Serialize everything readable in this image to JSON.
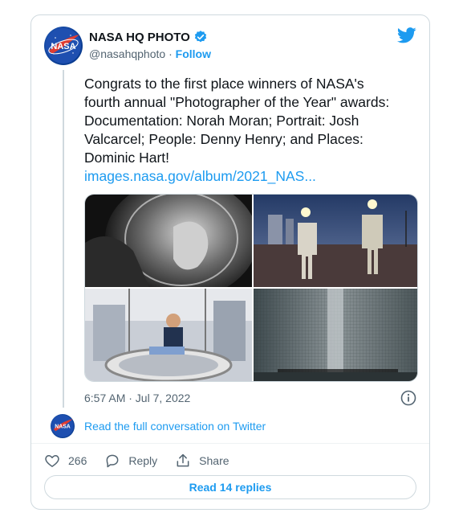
{
  "author": {
    "name": "NASA HQ PHOTO",
    "handle": "@nasahqphoto",
    "separator": "·",
    "follow_label": "Follow",
    "logo_text": "NASA"
  },
  "tweet": {
    "text": "Congrats to the first place winners of NASA's\nfourth annual \"Photographer of the Year\" awards:\nDocumentation: Norah Moran; Portrait: Josh\nValcarcel; People: Denny Henry; and Places:\nDominic Hart!",
    "link": "images.nasa.gov/album/2021_NAS...",
    "timestamp": "6:57 AM · Jul 7, 2022"
  },
  "media": [
    {
      "icon": "astronaut-portrait-photo"
    },
    {
      "icon": "spacesuit-night-photo"
    },
    {
      "icon": "worker-in-ring-photo"
    },
    {
      "icon": "large-hall-photo"
    }
  ],
  "conversation": {
    "read_full_label": "Read the full conversation on Twitter"
  },
  "actions": {
    "like_count": "266",
    "reply_label": "Reply",
    "share_label": "Share"
  },
  "footer": {
    "read_replies_label": "Read 14 replies"
  },
  "colors": {
    "accent": "#1d9bf0",
    "text": "#0f1419",
    "muted": "#536471",
    "border": "#cfd9de",
    "nasa_blue": "#0b3d91"
  }
}
